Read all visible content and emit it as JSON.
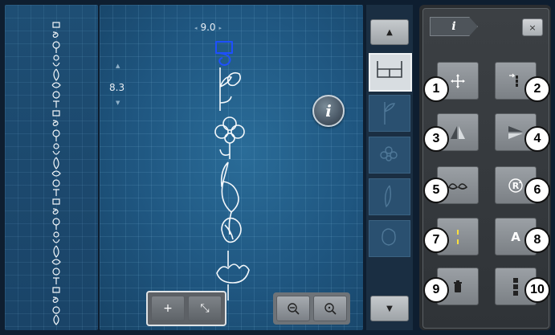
{
  "canvas": {
    "width_value": "9.0",
    "length_value": "8.3"
  },
  "info_button": {
    "label": "i"
  },
  "panel": {
    "tab_label": "i",
    "close_label": "×",
    "functions": [
      {
        "number": "1",
        "icon": "move-crosshair-icon"
      },
      {
        "number": "2",
        "icon": "shift-stitch-position-icon"
      },
      {
        "number": "3",
        "icon": "mirror-left-right-icon"
      },
      {
        "number": "4",
        "icon": "mirror-up-down-icon"
      },
      {
        "number": "5",
        "icon": "balance-icon"
      },
      {
        "number": "6",
        "icon": "pattern-repeat-icon"
      },
      {
        "number": "7",
        "icon": "stitch-length-icon"
      },
      {
        "number": "8",
        "icon": "text-size-icon"
      },
      {
        "number": "9",
        "icon": "delete-icon"
      },
      {
        "number": "10",
        "icon": "pattern-end-icon"
      }
    ],
    "func_labels": {
      "f6": "R",
      "f8": "A"
    }
  },
  "scroll": {
    "up_label": "▲",
    "down_label": "▼"
  },
  "bottom": {
    "pan_add_label": "+",
    "pan_expand_label": "⤡",
    "zoom_out_label": "−",
    "zoom_in_label": "+"
  }
}
